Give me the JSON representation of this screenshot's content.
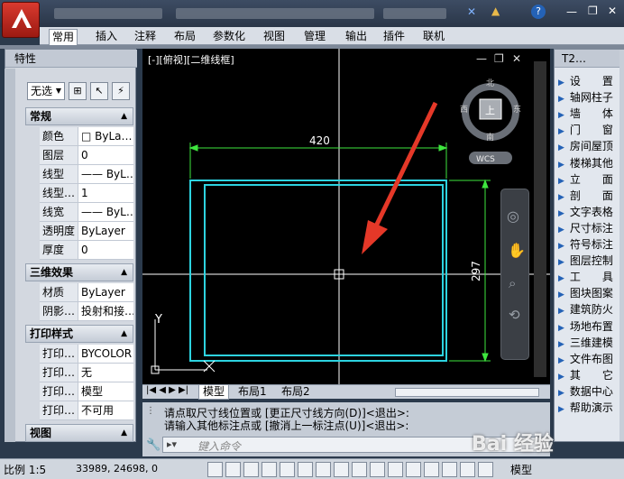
{
  "ribbon": {
    "tabs": [
      "常用",
      "插入",
      "注释",
      "布局",
      "参数化",
      "视图",
      "管理",
      "输出",
      "插件",
      "联机"
    ]
  },
  "properties": {
    "title": "特性",
    "selector": "无选",
    "groups": [
      {
        "name": "常规",
        "rows": [
          [
            "颜色",
            "□ ByLa…"
          ],
          [
            "图层",
            "0"
          ],
          [
            "线型",
            "—— ByL…"
          ],
          [
            "线型…",
            "1"
          ],
          [
            "线宽",
            "—— ByL…"
          ],
          [
            "透明度",
            "ByLayer"
          ],
          [
            "厚度",
            "0"
          ]
        ]
      },
      {
        "name": "三维效果",
        "rows": [
          [
            "材质",
            "ByLayer"
          ],
          [
            "阴影…",
            "投射和接…"
          ]
        ]
      },
      {
        "name": "打印样式",
        "rows": [
          [
            "打印…",
            "BYCOLOR"
          ],
          [
            "打印…",
            "无"
          ],
          [
            "打印…",
            "模型"
          ],
          [
            "打印…",
            "不可用"
          ]
        ]
      },
      {
        "name": "视图",
        "rows": []
      }
    ]
  },
  "viewport": {
    "label": "[-][俯视][二维线框]",
    "dim_horizontal": "420",
    "dim_vertical": "297",
    "viewcube": {
      "top": "上",
      "north": "北",
      "south": "南",
      "east": "东",
      "west": "西",
      "wcs": "WCS"
    },
    "ucs_y": "Y",
    "ucs_x": "X"
  },
  "layout_tabs": [
    "模型",
    "布局1",
    "布局2"
  ],
  "command": {
    "line1": "请点取尺寸线位置或  [更正尺寸线方向(D)]<退出>:",
    "line2": "请输入其他标注点或 [撤消上一标注点(U)]<退出>:",
    "placeholder": "键入命令"
  },
  "toolpalette": {
    "title": "T2…",
    "items": [
      "设　　置",
      "轴网柱子",
      "墙　　体",
      "门　　窗",
      "房间屋顶",
      "楼梯其他",
      "立　　面",
      "剖　　面",
      "文字表格",
      "尺寸标注",
      "符号标注",
      "图层控制",
      "工　　具",
      "图块图案",
      "建筑防火",
      "场地布置",
      "三维建模",
      "文件布图",
      "其　　它",
      "数据中心",
      "帮助演示"
    ]
  },
  "status": {
    "scale": "比例 1:5",
    "coords": "33989, 24698, 0",
    "model": "模型"
  },
  "watermark": "Bai 经验"
}
